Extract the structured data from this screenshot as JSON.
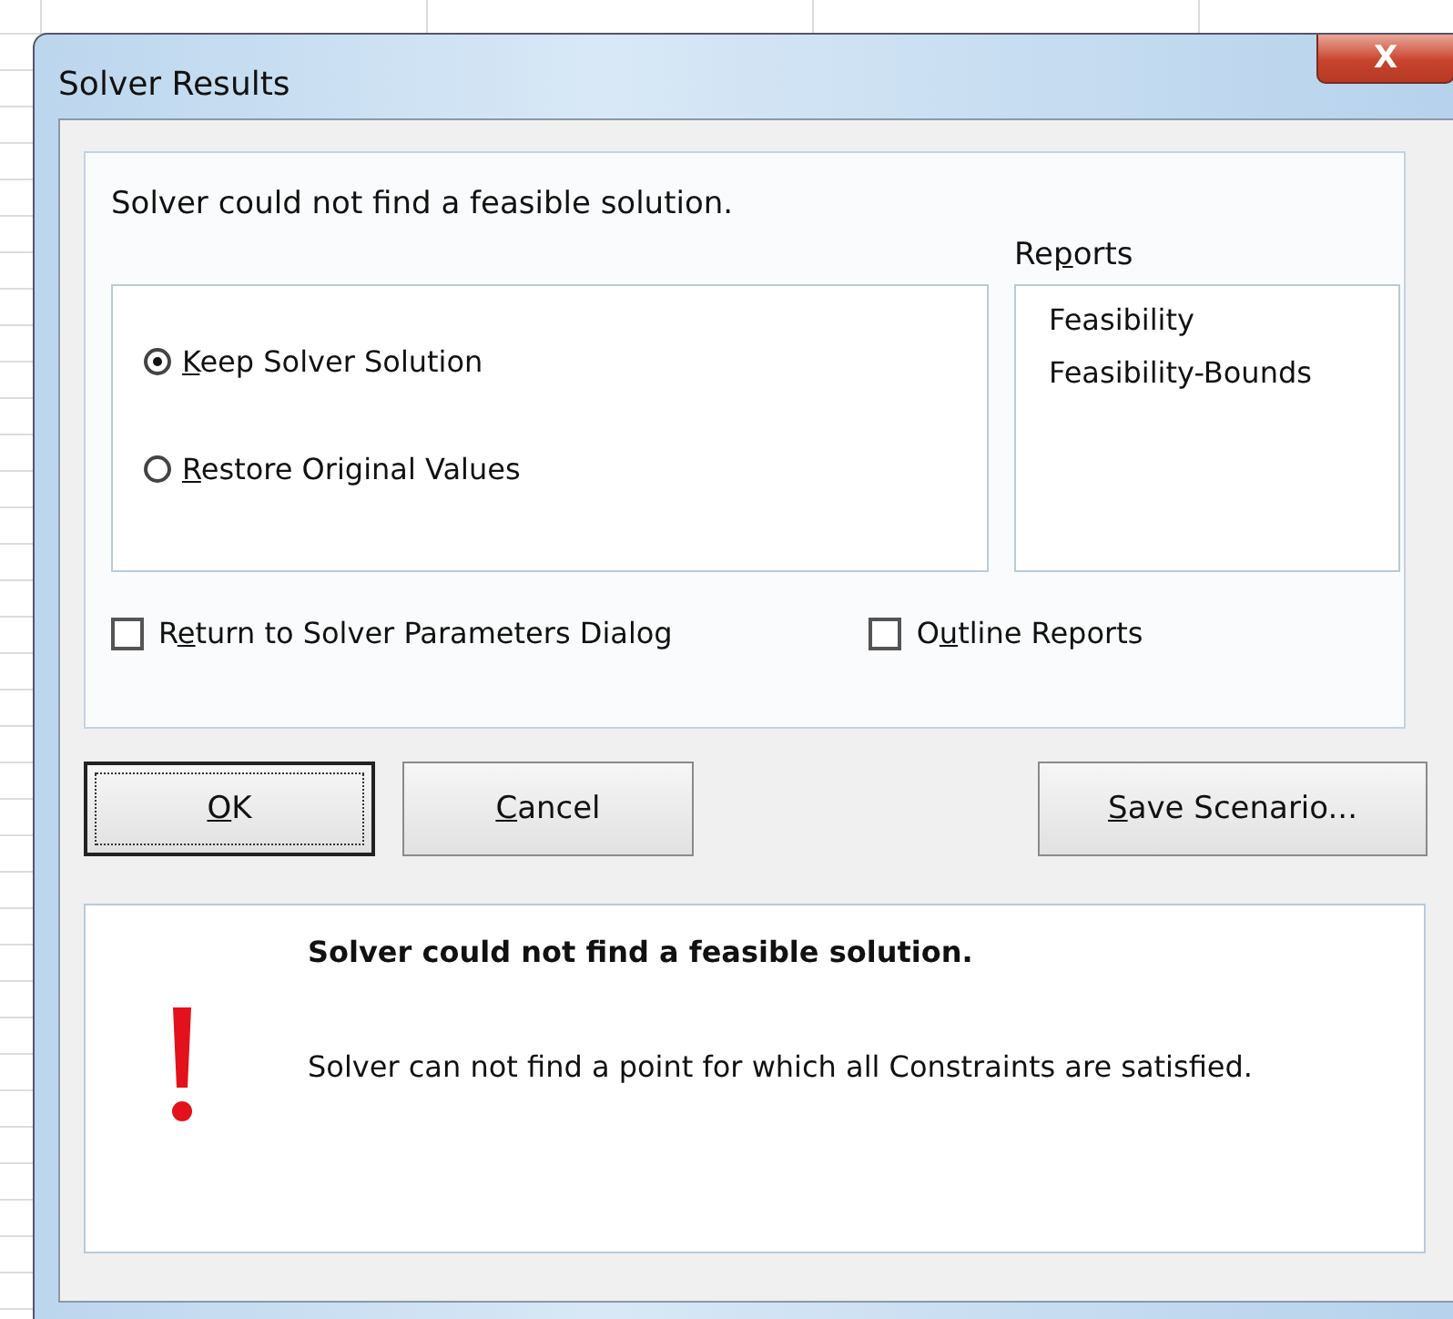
{
  "window": {
    "title": "Solver Results",
    "close_label": "X"
  },
  "message": "Solver could not find a feasible solution.",
  "options": [
    {
      "key": "K",
      "after": "eep Solver Solution",
      "selected": true
    },
    {
      "key": "R",
      "after": "estore Original Values",
      "selected": false
    }
  ],
  "reports": {
    "before": "Re",
    "key": "p",
    "after": "orts",
    "items": [
      "Feasibility",
      "Feasibility-Bounds"
    ]
  },
  "return_checkbox": {
    "before": "R",
    "key": "e",
    "after": "turn to Solver Parameters Dialog",
    "checked": false
  },
  "outline_checkbox": {
    "before": "O",
    "key": "u",
    "after": "tline Reports",
    "checked": false
  },
  "buttons": [
    {
      "key": "O",
      "after": "K",
      "default": true
    },
    {
      "key": "C",
      "after": "ancel",
      "default": false
    }
  ],
  "side_buttons": [
    {
      "key": "S",
      "after": "ave Scenario...",
      "default": false
    }
  ],
  "result": {
    "heading": "Solver could not find a feasible solution.",
    "detail": "Solver can not find a point for which all Constraints are satisfied."
  }
}
